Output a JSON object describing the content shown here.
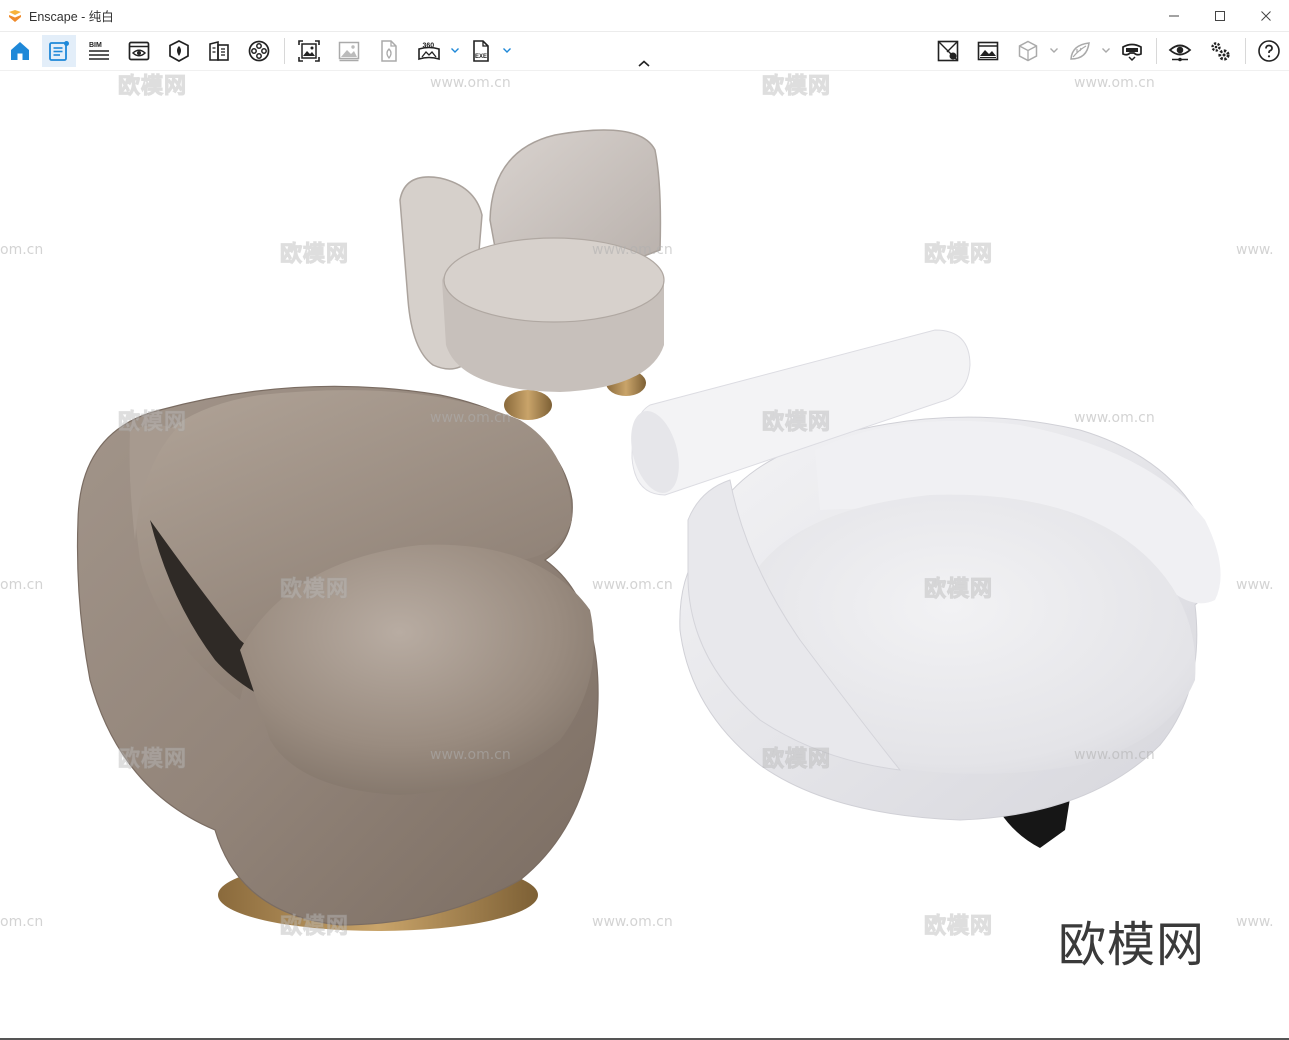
{
  "window": {
    "title": "Enscape - 纯白",
    "controls": {
      "minimize_icon": "minimize-icon",
      "maximize_icon": "maximize-icon",
      "close_icon": "close-icon"
    }
  },
  "toolbar": {
    "left_tools": [
      {
        "name": "home-icon",
        "active": false
      },
      {
        "name": "project-panel-icon",
        "active": true
      },
      {
        "name": "bim-icon",
        "label": "BIM"
      },
      {
        "name": "views-icon"
      },
      {
        "name": "asset-library-icon"
      },
      {
        "name": "material-editor-icon"
      },
      {
        "name": "video-editor-icon"
      },
      {
        "name": "render-image-icon"
      },
      {
        "name": "batch-render-icon"
      },
      {
        "name": "render-file-icon"
      },
      {
        "name": "panorama-icon",
        "label": "360"
      },
      {
        "name": "export-exe-icon",
        "label": "EXE"
      }
    ],
    "right_tools": [
      {
        "name": "screenshot-settings-icon"
      },
      {
        "name": "atmosphere-icon"
      },
      {
        "name": "cube-icon"
      },
      {
        "name": "leaf-icon"
      },
      {
        "name": "vr-headset-icon"
      },
      {
        "name": "visual-settings-icon"
      },
      {
        "name": "general-settings-icon"
      },
      {
        "name": "help-icon"
      }
    ],
    "collapse_icon": "chevron-up-icon"
  },
  "viewport": {
    "scene_description_icon": "three-lounge-chairs-render",
    "watermark_text": "欧模网",
    "watermark_url": "www.om.cn",
    "watermark_url_partial_left": "om.cn",
    "watermark_url_partial_right": "www.",
    "brand_watermark": "欧模网"
  },
  "colors": {
    "accent": "#1e88d8",
    "toolbar_bg": "#ffffff",
    "active_bg": "#e3eef9",
    "logo": "#f0a23a"
  }
}
